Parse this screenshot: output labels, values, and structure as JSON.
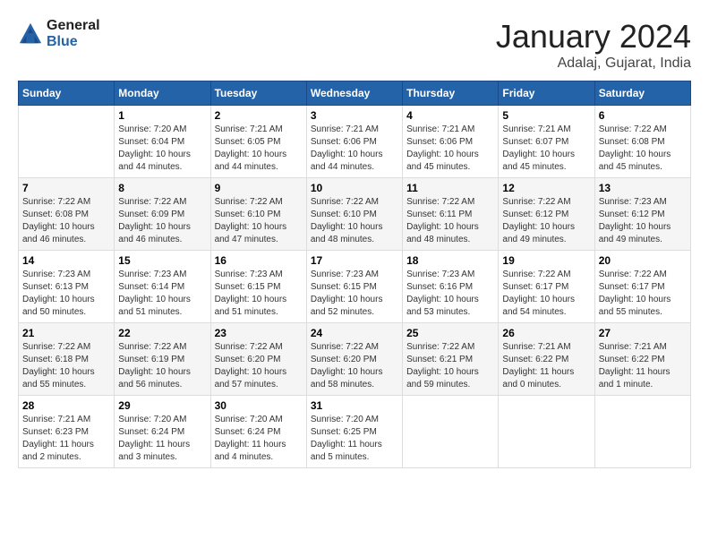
{
  "header": {
    "logo": {
      "line1": "General",
      "line2": "Blue"
    },
    "title": "January 2024",
    "location": "Adalaj, Gujarat, India"
  },
  "weekdays": [
    "Sunday",
    "Monday",
    "Tuesday",
    "Wednesday",
    "Thursday",
    "Friday",
    "Saturday"
  ],
  "weeks": [
    [
      {
        "day": "",
        "sunrise": "",
        "sunset": "",
        "daylight": ""
      },
      {
        "day": "1",
        "sunrise": "Sunrise: 7:20 AM",
        "sunset": "Sunset: 6:04 PM",
        "daylight": "Daylight: 10 hours and 44 minutes."
      },
      {
        "day": "2",
        "sunrise": "Sunrise: 7:21 AM",
        "sunset": "Sunset: 6:05 PM",
        "daylight": "Daylight: 10 hours and 44 minutes."
      },
      {
        "day": "3",
        "sunrise": "Sunrise: 7:21 AM",
        "sunset": "Sunset: 6:06 PM",
        "daylight": "Daylight: 10 hours and 44 minutes."
      },
      {
        "day": "4",
        "sunrise": "Sunrise: 7:21 AM",
        "sunset": "Sunset: 6:06 PM",
        "daylight": "Daylight: 10 hours and 45 minutes."
      },
      {
        "day": "5",
        "sunrise": "Sunrise: 7:21 AM",
        "sunset": "Sunset: 6:07 PM",
        "daylight": "Daylight: 10 hours and 45 minutes."
      },
      {
        "day": "6",
        "sunrise": "Sunrise: 7:22 AM",
        "sunset": "Sunset: 6:08 PM",
        "daylight": "Daylight: 10 hours and 45 minutes."
      }
    ],
    [
      {
        "day": "7",
        "sunrise": "Sunrise: 7:22 AM",
        "sunset": "Sunset: 6:08 PM",
        "daylight": "Daylight: 10 hours and 46 minutes."
      },
      {
        "day": "8",
        "sunrise": "Sunrise: 7:22 AM",
        "sunset": "Sunset: 6:09 PM",
        "daylight": "Daylight: 10 hours and 46 minutes."
      },
      {
        "day": "9",
        "sunrise": "Sunrise: 7:22 AM",
        "sunset": "Sunset: 6:10 PM",
        "daylight": "Daylight: 10 hours and 47 minutes."
      },
      {
        "day": "10",
        "sunrise": "Sunrise: 7:22 AM",
        "sunset": "Sunset: 6:10 PM",
        "daylight": "Daylight: 10 hours and 48 minutes."
      },
      {
        "day": "11",
        "sunrise": "Sunrise: 7:22 AM",
        "sunset": "Sunset: 6:11 PM",
        "daylight": "Daylight: 10 hours and 48 minutes."
      },
      {
        "day": "12",
        "sunrise": "Sunrise: 7:22 AM",
        "sunset": "Sunset: 6:12 PM",
        "daylight": "Daylight: 10 hours and 49 minutes."
      },
      {
        "day": "13",
        "sunrise": "Sunrise: 7:23 AM",
        "sunset": "Sunset: 6:12 PM",
        "daylight": "Daylight: 10 hours and 49 minutes."
      }
    ],
    [
      {
        "day": "14",
        "sunrise": "Sunrise: 7:23 AM",
        "sunset": "Sunset: 6:13 PM",
        "daylight": "Daylight: 10 hours and 50 minutes."
      },
      {
        "day": "15",
        "sunrise": "Sunrise: 7:23 AM",
        "sunset": "Sunset: 6:14 PM",
        "daylight": "Daylight: 10 hours and 51 minutes."
      },
      {
        "day": "16",
        "sunrise": "Sunrise: 7:23 AM",
        "sunset": "Sunset: 6:15 PM",
        "daylight": "Daylight: 10 hours and 51 minutes."
      },
      {
        "day": "17",
        "sunrise": "Sunrise: 7:23 AM",
        "sunset": "Sunset: 6:15 PM",
        "daylight": "Daylight: 10 hours and 52 minutes."
      },
      {
        "day": "18",
        "sunrise": "Sunrise: 7:23 AM",
        "sunset": "Sunset: 6:16 PM",
        "daylight": "Daylight: 10 hours and 53 minutes."
      },
      {
        "day": "19",
        "sunrise": "Sunrise: 7:22 AM",
        "sunset": "Sunset: 6:17 PM",
        "daylight": "Daylight: 10 hours and 54 minutes."
      },
      {
        "day": "20",
        "sunrise": "Sunrise: 7:22 AM",
        "sunset": "Sunset: 6:17 PM",
        "daylight": "Daylight: 10 hours and 55 minutes."
      }
    ],
    [
      {
        "day": "21",
        "sunrise": "Sunrise: 7:22 AM",
        "sunset": "Sunset: 6:18 PM",
        "daylight": "Daylight: 10 hours and 55 minutes."
      },
      {
        "day": "22",
        "sunrise": "Sunrise: 7:22 AM",
        "sunset": "Sunset: 6:19 PM",
        "daylight": "Daylight: 10 hours and 56 minutes."
      },
      {
        "day": "23",
        "sunrise": "Sunrise: 7:22 AM",
        "sunset": "Sunset: 6:20 PM",
        "daylight": "Daylight: 10 hours and 57 minutes."
      },
      {
        "day": "24",
        "sunrise": "Sunrise: 7:22 AM",
        "sunset": "Sunset: 6:20 PM",
        "daylight": "Daylight: 10 hours and 58 minutes."
      },
      {
        "day": "25",
        "sunrise": "Sunrise: 7:22 AM",
        "sunset": "Sunset: 6:21 PM",
        "daylight": "Daylight: 10 hours and 59 minutes."
      },
      {
        "day": "26",
        "sunrise": "Sunrise: 7:21 AM",
        "sunset": "Sunset: 6:22 PM",
        "daylight": "Daylight: 11 hours and 0 minutes."
      },
      {
        "day": "27",
        "sunrise": "Sunrise: 7:21 AM",
        "sunset": "Sunset: 6:22 PM",
        "daylight": "Daylight: 11 hours and 1 minute."
      }
    ],
    [
      {
        "day": "28",
        "sunrise": "Sunrise: 7:21 AM",
        "sunset": "Sunset: 6:23 PM",
        "daylight": "Daylight: 11 hours and 2 minutes."
      },
      {
        "day": "29",
        "sunrise": "Sunrise: 7:20 AM",
        "sunset": "Sunset: 6:24 PM",
        "daylight": "Daylight: 11 hours and 3 minutes."
      },
      {
        "day": "30",
        "sunrise": "Sunrise: 7:20 AM",
        "sunset": "Sunset: 6:24 PM",
        "daylight": "Daylight: 11 hours and 4 minutes."
      },
      {
        "day": "31",
        "sunrise": "Sunrise: 7:20 AM",
        "sunset": "Sunset: 6:25 PM",
        "daylight": "Daylight: 11 hours and 5 minutes."
      },
      {
        "day": "",
        "sunrise": "",
        "sunset": "",
        "daylight": ""
      },
      {
        "day": "",
        "sunrise": "",
        "sunset": "",
        "daylight": ""
      },
      {
        "day": "",
        "sunrise": "",
        "sunset": "",
        "daylight": ""
      }
    ]
  ]
}
